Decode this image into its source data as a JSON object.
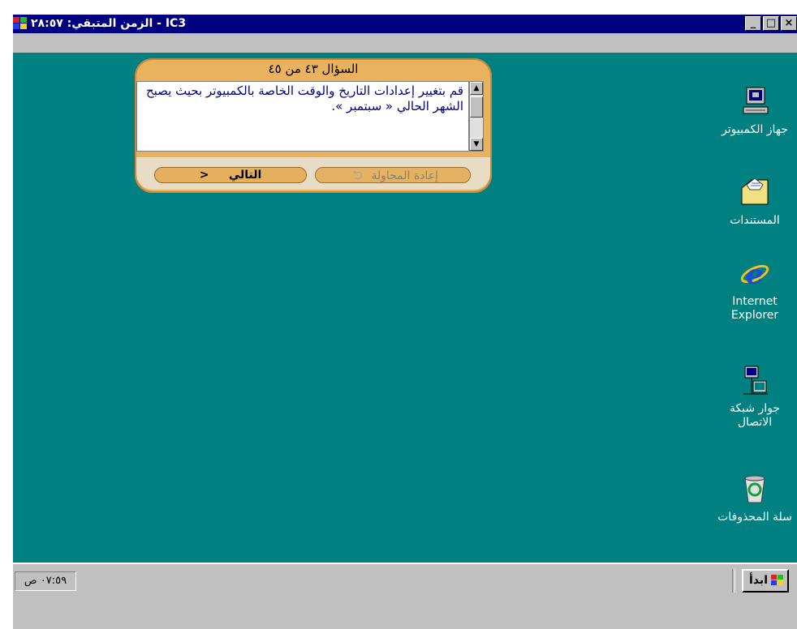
{
  "window": {
    "title": "الزمن المتبقي: ٢٨:٥٧ - IC3",
    "controls": {
      "minimize": "_",
      "maximize": "□",
      "close": "×"
    }
  },
  "question": {
    "header": "السؤال ٤٣ من ٤٥",
    "text": "قم بتغيير إعدادات التاريخ والوقت الخاصة بالكمبيوتر بحيث يصبح الشهر الحالي « سبتمبر ».",
    "next_label": "التالي",
    "next_arrow": "<",
    "retry_label": "إعادة المحاولة"
  },
  "desktop_icons": [
    {
      "name": "my-computer",
      "label": "جهاز الكمبيوتر"
    },
    {
      "name": "documents",
      "label": "المستندات"
    },
    {
      "name": "internet-explorer",
      "label_line1": "Internet",
      "label_line2": "Explorer"
    },
    {
      "name": "network",
      "label_line1": "جوار شبكة",
      "label_line2": "الاتصال"
    },
    {
      "name": "recycle-bin",
      "label": "سلة المحذوفات"
    }
  ],
  "taskbar": {
    "clock": "٠٧:٥٩ ص",
    "start_label": "ابدأ"
  }
}
